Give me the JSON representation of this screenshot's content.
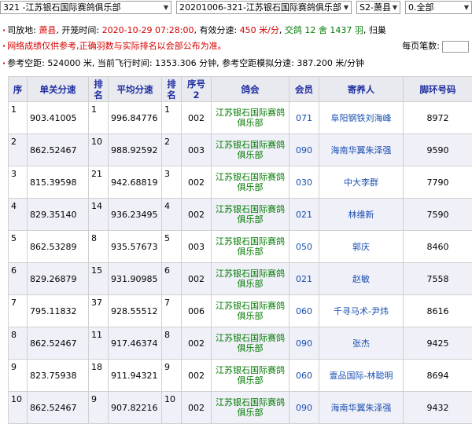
{
  "selectors": {
    "club": "321 -江苏银石国际赛鸽俱乐部",
    "race": "20201006-321-江苏银石国际赛鸽俱乐部",
    "venue": "S2-萧县",
    "group": "0.全部"
  },
  "info": {
    "release_place_label": "司放地:",
    "release_place": "萧县",
    "release_time_label": "开笼时间:",
    "release_time": "2020-10-29 07:28:00",
    "valid_speed_label": "有效分速:",
    "valid_speed": "450 米/分",
    "arrivals": "交鸽 12 舍 1437 羽",
    "arrivals_tail": "归巢",
    "notice": "网络成绩仅供参考,正确羽数与实际排名以会部公布为准。",
    "page_size_label": "每页笔数:",
    "ref_dist_label": "参考空距:",
    "ref_dist": "524000 米",
    "cur_time_label": "当前飞行时间:",
    "cur_time": "1353.306 分钟",
    "ref_speed_label": "参考空距模拟分速:",
    "ref_speed": "387.200 米/分钟"
  },
  "columns": [
    "序",
    "单关分速",
    "排名",
    "平均分速",
    "排名",
    "序号2",
    "鸽会",
    "会员",
    "寄养人",
    "脚环号码"
  ],
  "rows": [
    {
      "seq": "1",
      "speed": "903.41005",
      "rank": "1",
      "avg": "996.84776",
      "rank2": "1",
      "cage": "002",
      "club": "江苏银石国际赛鸽俱乐部",
      "member": "071",
      "owner": "阜阳钢铁刘海峰",
      "ring": "8972"
    },
    {
      "seq": "2",
      "speed": "862.52467",
      "rank": "10",
      "avg": "988.92592",
      "rank2": "2",
      "cage": "003",
      "club": "江苏银石国际赛鸽俱乐部",
      "member": "090",
      "owner": "海南华翼朱泽强",
      "ring": "9590"
    },
    {
      "seq": "3",
      "speed": "815.39598",
      "rank": "21",
      "avg": "942.68819",
      "rank2": "3",
      "cage": "002",
      "club": "江苏银石国际赛鸽俱乐部",
      "member": "030",
      "owner": "中大李群",
      "ring": "7790"
    },
    {
      "seq": "4",
      "speed": "829.35140",
      "rank": "14",
      "avg": "936.23495",
      "rank2": "4",
      "cage": "002",
      "club": "江苏银石国际赛鸽俱乐部",
      "member": "021",
      "owner": "林维新",
      "ring": "7590"
    },
    {
      "seq": "5",
      "speed": "862.53289",
      "rank": "8",
      "avg": "935.57673",
      "rank2": "5",
      "cage": "003",
      "club": "江苏银石国际赛鸽俱乐部",
      "member": "050",
      "owner": "郭庆",
      "ring": "8460"
    },
    {
      "seq": "6",
      "speed": "829.26879",
      "rank": "15",
      "avg": "931.90985",
      "rank2": "6",
      "cage": "002",
      "club": "江苏银石国际赛鸽俱乐部",
      "member": "021",
      "owner": "赵敏",
      "ring": "7558"
    },
    {
      "seq": "7",
      "speed": "795.11832",
      "rank": "37",
      "avg": "928.55512",
      "rank2": "7",
      "cage": "006",
      "club": "江苏银石国际赛鸽俱乐部",
      "member": "060",
      "owner": "千寻马术-尹炜",
      "ring": "8616"
    },
    {
      "seq": "8",
      "speed": "862.52467",
      "rank": "11",
      "avg": "917.46374",
      "rank2": "8",
      "cage": "002",
      "club": "江苏银石国际赛鸽俱乐部",
      "member": "090",
      "owner": "张杰",
      "ring": "9425"
    },
    {
      "seq": "9",
      "speed": "823.75938",
      "rank": "18",
      "avg": "911.94321",
      "rank2": "9",
      "cage": "002",
      "club": "江苏银石国际赛鸽俱乐部",
      "member": "060",
      "owner": "壹品国际-林聪明",
      "ring": "8694"
    },
    {
      "seq": "10",
      "speed": "862.52467",
      "rank": "9",
      "avg": "907.82216",
      "rank2": "10",
      "cage": "002",
      "club": "江苏银石国际赛鸽俱乐部",
      "member": "090",
      "owner": "海南华翼朱泽强",
      "ring": "9432"
    }
  ]
}
